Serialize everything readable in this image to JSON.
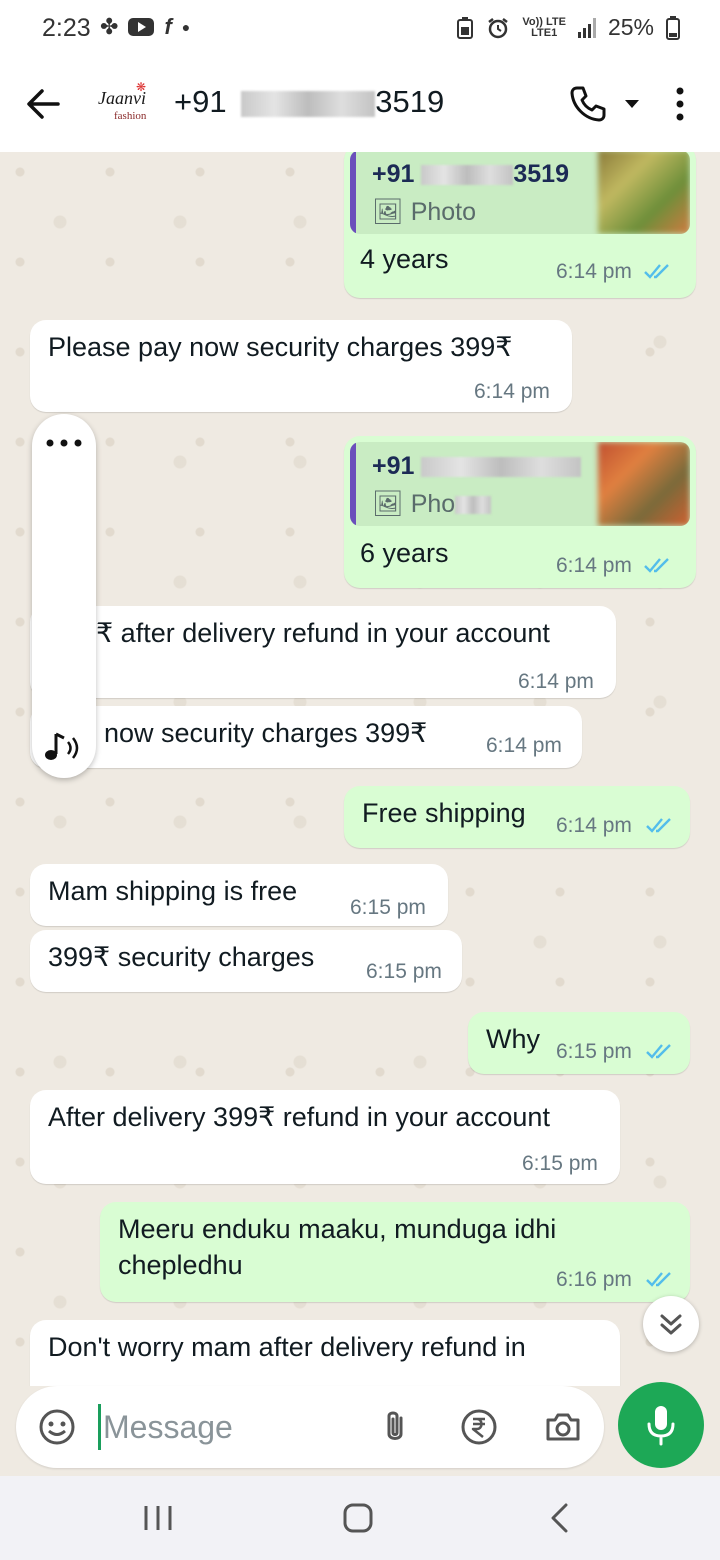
{
  "status_bar": {
    "time": "2:23",
    "network_top": "Vo)) LTE",
    "network_bottom": "LTE1",
    "battery": "25%"
  },
  "header": {
    "logo_main": "Jaanvi",
    "logo_sub": "fashion",
    "contact_prefix": "+91",
    "contact_suffix": "3519"
  },
  "messages": [
    {
      "dir": "out",
      "quote_name_prefix": "+91",
      "quote_name_suffix": "3519",
      "quote_type": "Photo",
      "text": "4 years",
      "time": "6:14 pm"
    },
    {
      "dir": "in",
      "text": "Please pay now security charges 399₹",
      "time": "6:14 pm"
    },
    {
      "dir": "out",
      "quote_name_prefix": "+91",
      "quote_type": "Pho",
      "text": "6 years",
      "time": "6:14 pm"
    },
    {
      "dir": "in",
      "text": "₹ after delivery refund in your account",
      "time": "6:14 pm"
    },
    {
      "dir": "in",
      "text": "now security charges 399₹",
      "time": "6:14 pm"
    },
    {
      "dir": "out",
      "text": "Free shipping",
      "time": "6:14 pm"
    },
    {
      "dir": "in",
      "text": "Mam shipping is free",
      "time": "6:15 pm"
    },
    {
      "dir": "in",
      "text": "399₹ security charges",
      "time": "6:15 pm"
    },
    {
      "dir": "out",
      "text": "Why",
      "time": "6:15 pm"
    },
    {
      "dir": "in",
      "text": "After delivery 399₹ refund in your account",
      "time": "6:15 pm"
    },
    {
      "dir": "out",
      "text_line1": "Meeru enduku maaku, munduga idhi",
      "text_line2": "chepledhu",
      "time": "6:16 pm"
    },
    {
      "dir": "in",
      "text": "Don't worry mam after delivery refund in"
    }
  ],
  "input": {
    "placeholder": "Message"
  },
  "icons": {
    "back": "arrow-left-icon",
    "call": "phone-icon",
    "menu": "more-vert-icon",
    "emoji": "sticker-icon",
    "attach": "paperclip-icon",
    "payment": "rupee-icon",
    "camera": "camera-icon",
    "mic": "mic-icon"
  },
  "colors": {
    "outgoing_bubble": "#d9fdd3",
    "incoming_bubble": "#ffffff",
    "read_ticks": "#53bdeb",
    "accent_green": "#1da856",
    "quote_bar": "#6b4fbb"
  }
}
